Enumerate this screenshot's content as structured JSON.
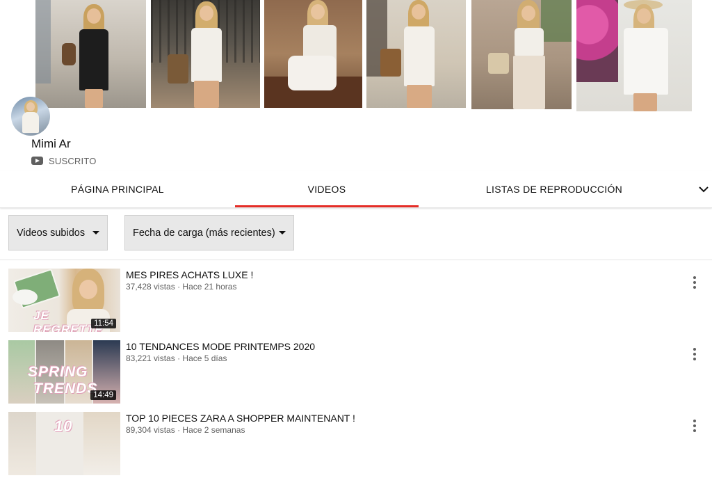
{
  "banner": {
    "photos": [
      {
        "id": "p1",
        "scene": "street-black-outfit"
      },
      {
        "id": "p2",
        "scene": "gate-white-top"
      },
      {
        "id": "p3",
        "scene": "bench-knit-top"
      },
      {
        "id": "p4",
        "scene": "brick-wall-white-outfit"
      },
      {
        "id": "p5",
        "scene": "window-crop-top"
      },
      {
        "id": "p6",
        "scene": "flowers-white-dress"
      }
    ]
  },
  "channel": {
    "name": "Mimi Ar",
    "subscribed_label": "SUSCRITO",
    "avatar_icon": "channel-avatar",
    "subscribed_icon": "youtube-play-icon"
  },
  "tabs": {
    "items": [
      {
        "label": "PÁGINA PRINCIPAL"
      },
      {
        "label": "VIDEOS"
      },
      {
        "label": "LISTAS DE REPRODUCCIÓN"
      }
    ],
    "active_index": 1,
    "more_icon": "chevron-down-icon",
    "accent_color": "#e52d27"
  },
  "filters": {
    "type": {
      "value": "Videos subidos",
      "icon": "dropdown-caret-icon"
    },
    "sort": {
      "value": "Fecha de carga (más recientes)",
      "icon": "dropdown-caret-icon"
    }
  },
  "videos": [
    {
      "title": "MES PIRES ACHATS LUXE !",
      "views": "37,428 vistas",
      "separator": "·",
      "age": "Hace 21 horas",
      "duration": "11:54",
      "thumb_text": "JE REGRETTE"
    },
    {
      "title": "10 TENDANCES MODE PRINTEMPS 2020",
      "views": "83,221 vistas",
      "separator": "·",
      "age": "Hace 5 días",
      "duration": "14:49",
      "thumb_text_1": "SPRING",
      "thumb_text_2": "TRENDS"
    },
    {
      "title": "TOP 10 PIECES ZARA A SHOPPER MAINTENANT !",
      "views": "89,304 vistas",
      "separator": "·",
      "age": "Hace 2 semanas",
      "thumb_text": "10"
    }
  ],
  "colors": {
    "text_primary": "#0f0f0f",
    "text_secondary": "#606060",
    "filter_bg": "#e8e8e8"
  }
}
